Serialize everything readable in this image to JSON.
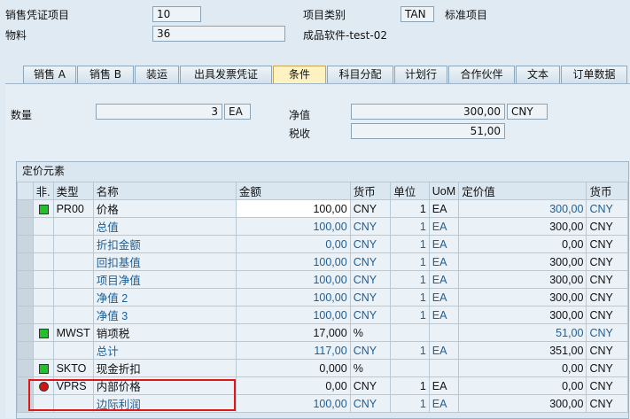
{
  "header": {
    "item_label": "销售凭证项目",
    "item_value": "10",
    "category_label": "项目类别",
    "category_value": "TAN",
    "category_desc": "标准项目",
    "material_label": "物料",
    "material_value": "36",
    "material_desc": "成品软件-test-02"
  },
  "tabs": [
    "销售 A",
    "销售 B",
    "装运",
    "出具发票凭证",
    "条件",
    "科目分配",
    "计划行",
    "合作伙伴",
    "文本",
    "订单数据"
  ],
  "active_tab": "条件",
  "summary": {
    "qty_label": "数量",
    "qty_value": "3",
    "qty_unit": "EA",
    "net_label": "净值",
    "net_value": "300,00",
    "net_currency": "CNY",
    "tax_label": "税收",
    "tax_value": "51,00"
  },
  "group_title": "定价元素",
  "columns": [
    "非.",
    "类型",
    "名称",
    "金额",
    "货币",
    "单位",
    "UoM",
    "定价值",
    "货币"
  ],
  "rows": [
    {
      "lamp": "green",
      "type": "PR00",
      "name": "价格",
      "amount": "100,00",
      "cur": "CNY",
      "unit": "1",
      "uom": "EA",
      "value": "300,00",
      "cur2": "CNY",
      "blue": false,
      "valblue": true,
      "white": true
    },
    {
      "lamp": "",
      "type": "",
      "name": "总值",
      "amount": "100,00",
      "cur": "CNY",
      "unit": "1",
      "uom": "EA",
      "value": "300,00",
      "cur2": "CNY",
      "blue": true,
      "valblue": false
    },
    {
      "lamp": "",
      "type": "",
      "name": "折扣金额",
      "amount": "0,00",
      "cur": "CNY",
      "unit": "1",
      "uom": "EA",
      "value": "0,00",
      "cur2": "CNY",
      "blue": true,
      "valblue": false
    },
    {
      "lamp": "",
      "type": "",
      "name": "回扣基值",
      "amount": "100,00",
      "cur": "CNY",
      "unit": "1",
      "uom": "EA",
      "value": "300,00",
      "cur2": "CNY",
      "blue": true,
      "valblue": false
    },
    {
      "lamp": "",
      "type": "",
      "name": "项目净值",
      "amount": "100,00",
      "cur": "CNY",
      "unit": "1",
      "uom": "EA",
      "value": "300,00",
      "cur2": "CNY",
      "blue": true,
      "valblue": false
    },
    {
      "lamp": "",
      "type": "",
      "name": "净值 2",
      "amount": "100,00",
      "cur": "CNY",
      "unit": "1",
      "uom": "EA",
      "value": "300,00",
      "cur2": "CNY",
      "blue": true,
      "valblue": false
    },
    {
      "lamp": "",
      "type": "",
      "name": "净值 3",
      "amount": "100,00",
      "cur": "CNY",
      "unit": "1",
      "uom": "EA",
      "value": "300,00",
      "cur2": "CNY",
      "blue": true,
      "valblue": false
    },
    {
      "lamp": "green",
      "type": "MWST",
      "name": "销项税",
      "amount": "17,000",
      "cur": "%",
      "unit": "",
      "uom": "",
      "value": "51,00",
      "cur2": "CNY",
      "blue": false,
      "valblue": true
    },
    {
      "lamp": "",
      "type": "",
      "name": "总计",
      "amount": "117,00",
      "cur": "CNY",
      "unit": "1",
      "uom": "EA",
      "value": "351,00",
      "cur2": "CNY",
      "blue": true,
      "valblue": false
    },
    {
      "lamp": "green",
      "type": "SKTO",
      "name": "现金折扣",
      "amount": "0,000",
      "cur": "%",
      "unit": "",
      "uom": "",
      "value": "0,00",
      "cur2": "CNY",
      "blue": false,
      "valblue": false
    },
    {
      "lamp": "red",
      "type": "VPRS",
      "name": "内部价格",
      "amount": "0,00",
      "cur": "CNY",
      "unit": "1",
      "uom": "EA",
      "value": "0,00",
      "cur2": "CNY",
      "blue": false,
      "valblue": false
    },
    {
      "lamp": "",
      "type": "",
      "name": "边际利润",
      "amount": "100,00",
      "cur": "CNY",
      "unit": "1",
      "uom": "EA",
      "value": "300,00",
      "cur2": "CNY",
      "blue": true,
      "valblue": false
    }
  ]
}
